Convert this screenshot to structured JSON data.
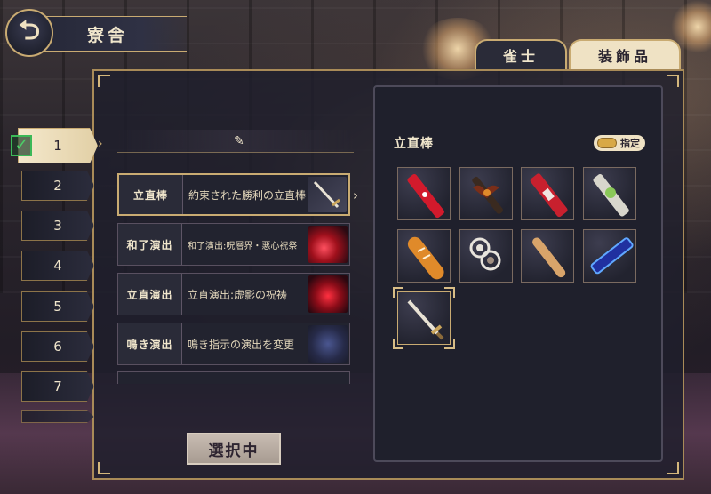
{
  "header": {
    "back_glyph": "⮌",
    "title": "寮舎"
  },
  "tabs": [
    {
      "label": "雀士",
      "active": false
    },
    {
      "label": "装飾品",
      "active": true
    }
  ],
  "slots": [
    "1",
    "2",
    "3",
    "4",
    "5",
    "6",
    "7"
  ],
  "active_slot": "1",
  "equip_rows": [
    {
      "label": "立直棒",
      "value": "約束された勝利の立直棒",
      "thumb": "sword-icon",
      "selected": true
    },
    {
      "label": "和了演出",
      "value": "和了演出:呪層界・悪心祝祭",
      "thumb": "red-burst-icon",
      "selected": false
    },
    {
      "label": "立直演出",
      "value": "立直演出:虚影の祝祷",
      "thumb": "red-wings-icon",
      "selected": false
    },
    {
      "label": "鳴き演出",
      "value": "鳴き指示の演出を変更",
      "thumb": "sparkle-icon",
      "selected": false
    }
  ],
  "selecting_button": "選択中",
  "right_panel": {
    "title": "立直棒",
    "toggle_label": "指定"
  },
  "items": [
    {
      "name": "red-stick-item"
    },
    {
      "name": "bat-stick-item"
    },
    {
      "name": "red-candy-stick-item"
    },
    {
      "name": "green-stick-item"
    },
    {
      "name": "bread-stick-item"
    },
    {
      "name": "swirl-stick-item"
    },
    {
      "name": "baseball-bat-item"
    },
    {
      "name": "blue-neon-stick-item"
    },
    {
      "name": "sword-item"
    }
  ],
  "colors": {
    "accent_gold": "#c9ab72",
    "panel_dark": "#1f202c",
    "tab_active": "#efe2c4",
    "check_green": "#3cb858"
  }
}
